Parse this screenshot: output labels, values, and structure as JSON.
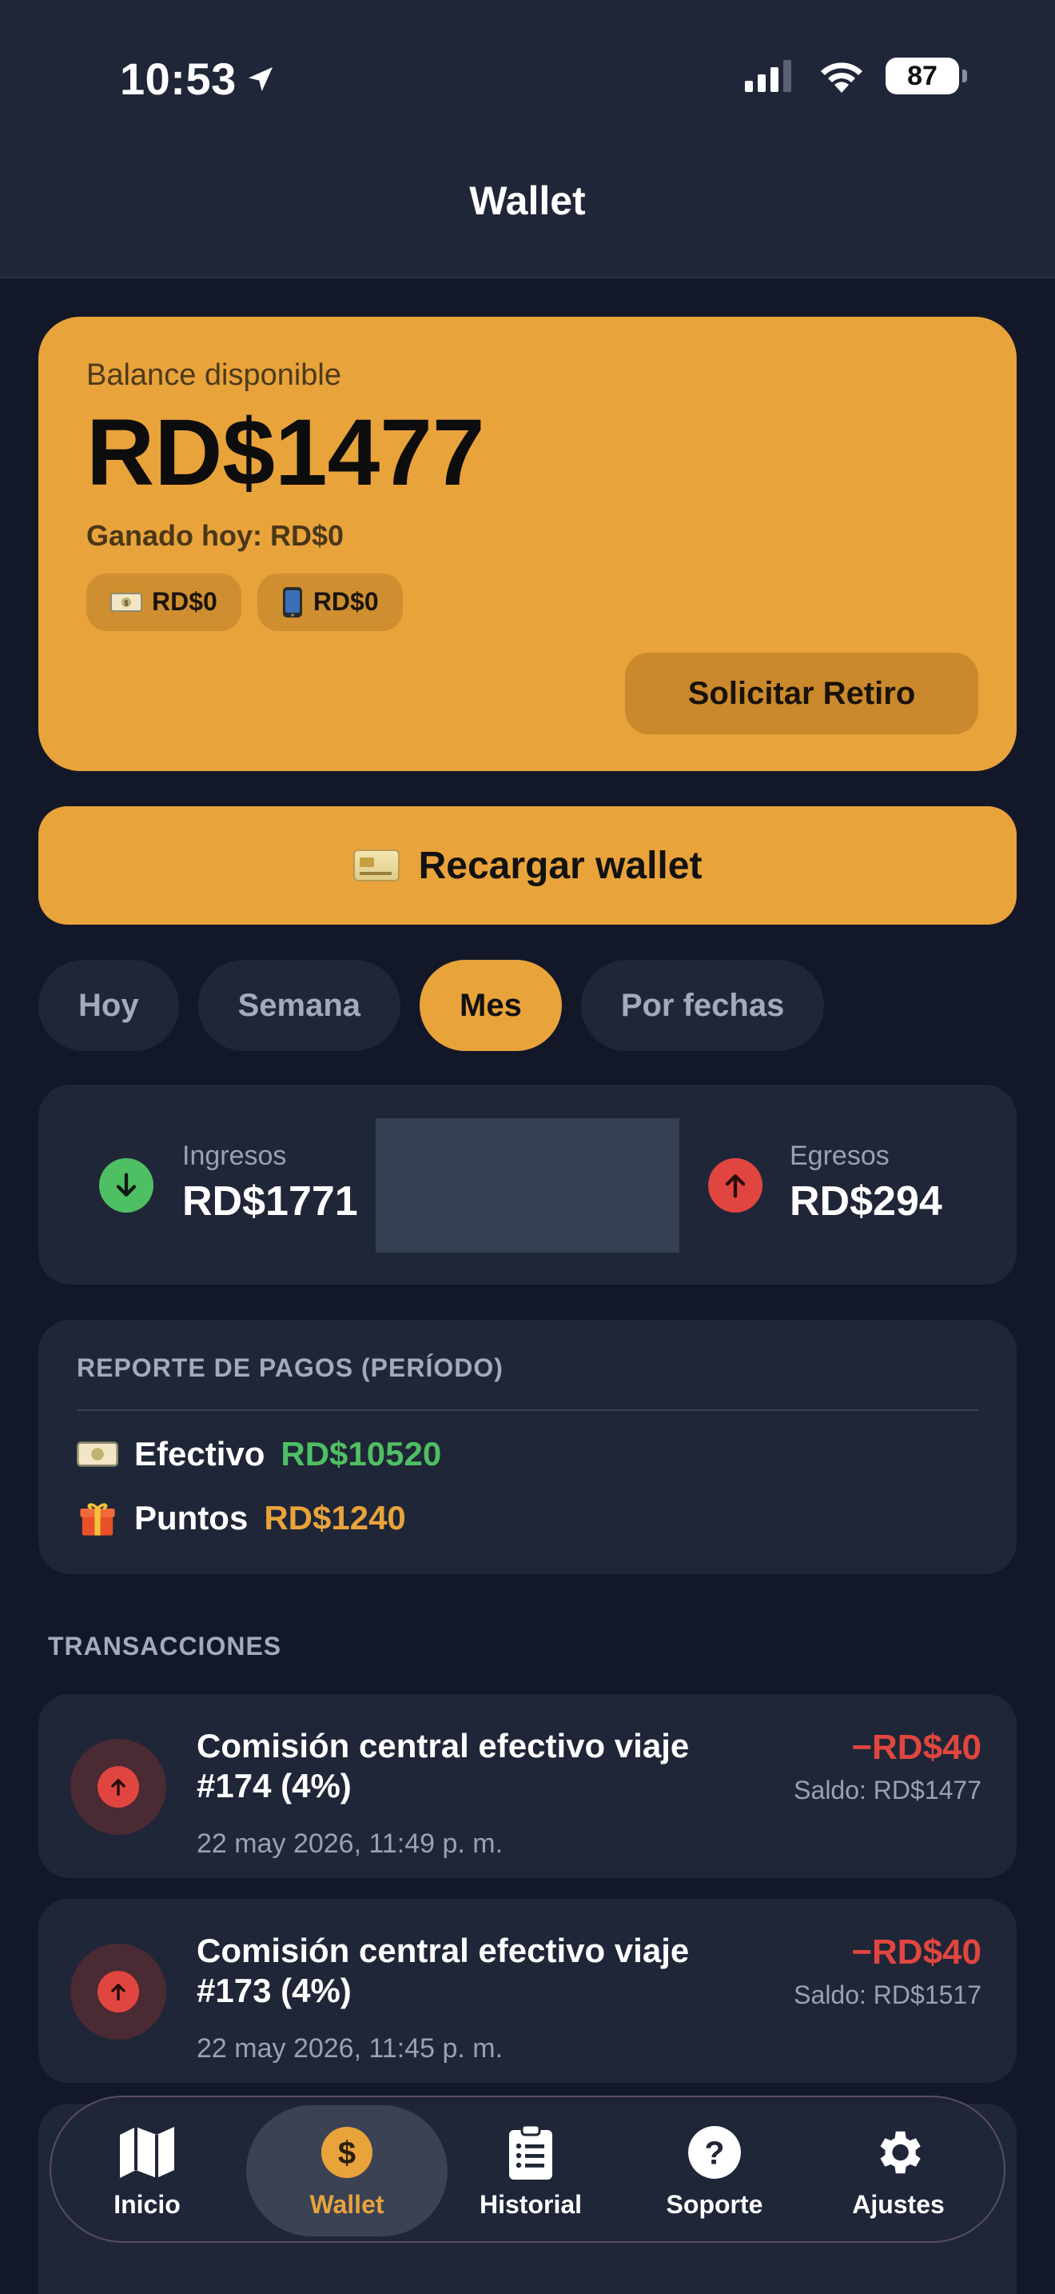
{
  "status_bar": {
    "time": "10:53",
    "battery": "87"
  },
  "header": {
    "title": "Wallet"
  },
  "balance": {
    "label": "Balance disponible",
    "amount": "RD$1477",
    "earned_today": "Ganado hoy: RD$0",
    "chips": [
      {
        "icon": "cash-icon",
        "value": "RD$0"
      },
      {
        "icon": "phone-icon",
        "value": "RD$0"
      }
    ],
    "withdraw_label": "Solicitar Retiro"
  },
  "recharge": {
    "label": "Recargar wallet",
    "icon": "credit-card-icon"
  },
  "period_tabs": [
    {
      "label": "Hoy",
      "active": false
    },
    {
      "label": "Semana",
      "active": false
    },
    {
      "label": "Mes",
      "active": true
    },
    {
      "label": "Por fechas",
      "active": false
    }
  ],
  "summary": {
    "income_label": "Ingresos",
    "income_value": "RD$1771",
    "expense_label": "Egresos",
    "expense_value": "RD$294"
  },
  "report": {
    "title": "REPORTE DE PAGOS (PERÍODO)",
    "rows": [
      {
        "icon": "cash-icon",
        "label": "Efectivo",
        "value": "RD$10520",
        "color": "#4fbf63"
      },
      {
        "icon": "gift-icon",
        "label": "Puntos",
        "value": "RD$1240",
        "color": "#e9a33b"
      }
    ]
  },
  "transactions": {
    "title": "TRANSACCIONES",
    "items": [
      {
        "title": "Comisión central efectivo viaje #174 (4%)",
        "date": "22 may 2026, 11:49 p. m.",
        "amount": "−RD$40",
        "saldo": "Saldo: RD$1477"
      },
      {
        "title": "Comisión central efectivo viaje #173 (4%)",
        "date": "22 may 2026, 11:45 p. m.",
        "amount": "−RD$40",
        "saldo": "Saldo: RD$1517"
      }
    ]
  },
  "colors": {
    "accent": "#e9a33b",
    "background": "#121828",
    "card": "#1f2637",
    "positive": "#4fbf63",
    "negative": "#e0463f"
  },
  "nav": {
    "items": [
      {
        "label": "Inicio",
        "icon": "map-icon",
        "active": false
      },
      {
        "label": "Wallet",
        "icon": "dollar-icon",
        "active": true
      },
      {
        "label": "Historial",
        "icon": "clipboard-list-icon",
        "active": false
      },
      {
        "label": "Soporte",
        "icon": "help-icon",
        "active": false
      },
      {
        "label": "Ajustes",
        "icon": "gear-icon",
        "active": false
      }
    ]
  }
}
